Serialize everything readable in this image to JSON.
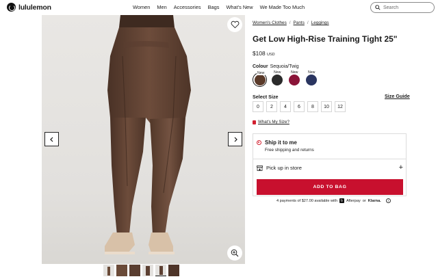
{
  "header": {
    "brand": "lululemon",
    "nav": [
      "Women",
      "Men",
      "Accessories",
      "Bags",
      "What's New",
      "We Made Too Much"
    ],
    "search_placeholder": "Search"
  },
  "gallery": {
    "prev_icon": "chevron-left-icon",
    "next_icon": "chevron-right-icon",
    "wishlist_icon": "heart-icon",
    "zoom_icon": "zoom-in-icon",
    "thumbnail_count": 6,
    "active_thumbnail": 5
  },
  "product": {
    "breadcrumbs": [
      "Women's Clothes",
      "Pants",
      "Leggings"
    ],
    "title": "Get Low High-Rise Training Tight 25\"",
    "price": "$108",
    "currency": "USD",
    "colour_label": "Colour",
    "colour_value": "Sequoia/Twig",
    "swatches": [
      {
        "new": "New",
        "color": "#5a3a2a",
        "selected": true
      },
      {
        "new": "New",
        "color": "#2b2b2b",
        "selected": false
      },
      {
        "new": "New",
        "color": "#8a1438",
        "selected": false
      },
      {
        "new": "New",
        "color": "#2a3560",
        "selected": false
      }
    ],
    "size_label": "Select Size",
    "size_guide": "Size Guide",
    "sizes": [
      "0",
      "2",
      "4",
      "6",
      "8",
      "10",
      "12"
    ],
    "whats_my_size": "What's My Size?"
  },
  "fulfilment": {
    "ship_title": "Ship it to me",
    "ship_sub": "Free shipping and returns",
    "pickup": "Pick up in store",
    "add_to_bag": "ADD TO BAG"
  },
  "payment": {
    "text": "4 payments of $27.00 available with",
    "afterpay": "Afterpay",
    "or": "or",
    "klarna": "Klarna."
  },
  "colors": {
    "accent": "#c8102e",
    "product": "#6a4a38"
  }
}
